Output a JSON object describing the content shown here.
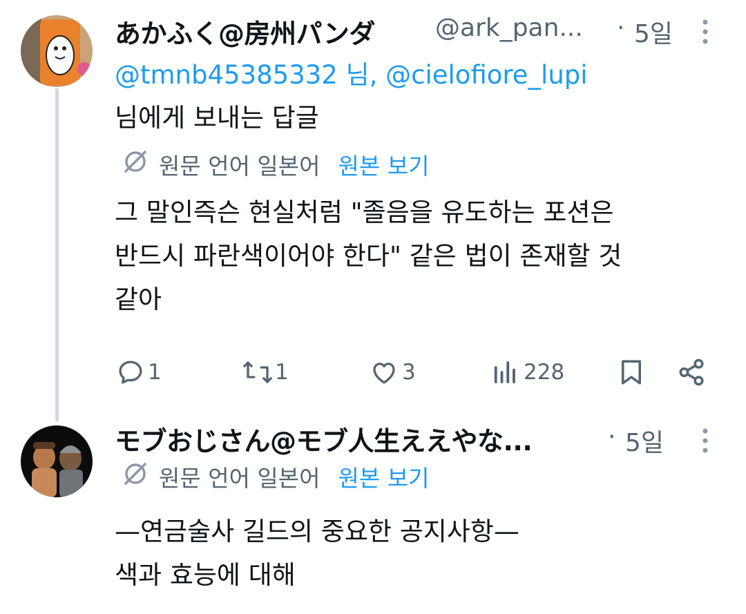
{
  "tweets": [
    {
      "author_name": "あかふく@房州パンダ",
      "handle": "@ark_pan...",
      "separator": "·",
      "time": "5일",
      "more_icon": "more-vertical-icon",
      "reply_to": {
        "mention1": "@tmnb45385332",
        "suffix1": " 님, ",
        "mention2": "@cielofiore_lupi",
        "line2": "님에게 보내는 답글"
      },
      "translation": {
        "label": "원문 언어 일본어",
        "link": "원본 보기"
      },
      "text_lines": [
        "그 말인즉슨 현실처럼 \"졸음을 유도하는 포션은",
        "반드시 파란색이어야 한다\" 같은 법이 존재할 것",
        "같아"
      ],
      "stats": {
        "replies": "1",
        "retweets": "1",
        "likes": "3",
        "views": "228"
      }
    },
    {
      "author_name": "モブおじさん@モブ人生ええやな...",
      "separator": "·",
      "time": "5일",
      "translation": {
        "label": "원문 언어 일본어",
        "link": "원본 보기"
      },
      "text_lines": [
        "—연금술사 길드의 중요한 공지사항—",
        "색과 효능에 대해"
      ]
    }
  ],
  "colors": {
    "link": "#1d9bf0",
    "muted": "#536471",
    "text": "#0f1419",
    "thread_line": "#cfd9de"
  }
}
